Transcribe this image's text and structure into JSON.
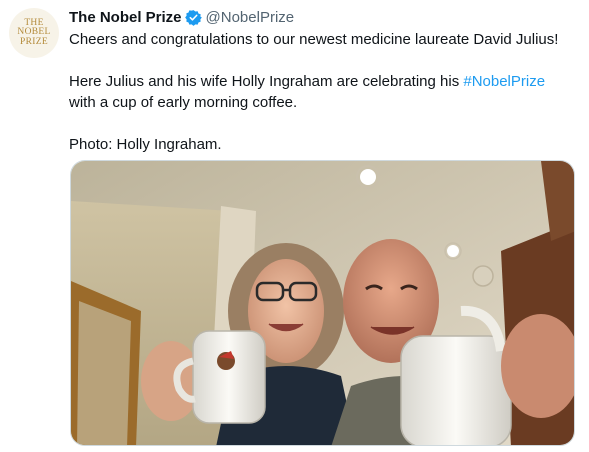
{
  "avatar": {
    "logo_lines": [
      "THE",
      "NOBEL",
      "PRIZE"
    ]
  },
  "author": {
    "display_name": "The Nobel Prize",
    "handle": "@NobelPrize",
    "verified": true
  },
  "tweet": {
    "line1": "Cheers and congratulations to our newest medicine laureate David Julius!",
    "line2_before": "Here Julius and his wife Holly Ingraham are celebrating his ",
    "hashtag": "#NobelPrize",
    "line2_after": "with a cup of early morning coffee.",
    "line3": "Photo: Holly Ingraham."
  },
  "media": {
    "icon": "photo",
    "subject": "two people toasting with coffee mugs"
  },
  "colors": {
    "text": "#0f1419",
    "secondary": "#536471",
    "link": "#1d9bf0",
    "verified": "#1d9bf0",
    "logo_gold": "#b38a3a"
  }
}
